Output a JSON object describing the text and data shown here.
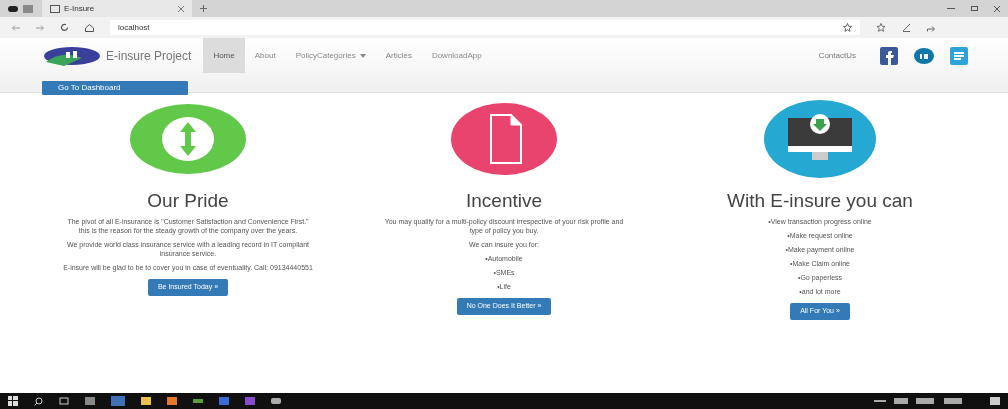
{
  "browser": {
    "tab_title": "E-Insure",
    "url": "localhost"
  },
  "navbar": {
    "brand": "E-insure Project",
    "items": [
      {
        "label": "Home",
        "kind": "link",
        "selected": true
      },
      {
        "label": "About",
        "kind": "link",
        "selected": false
      },
      {
        "label": "PolicyCategories",
        "kind": "dropdown",
        "selected": false
      },
      {
        "label": "Articles",
        "kind": "link",
        "selected": false
      },
      {
        "label": "DownloadApp",
        "kind": "link",
        "selected": false
      }
    ],
    "contact": "ContactUs",
    "dashboard_button": "Go To Dashboard"
  },
  "features": [
    {
      "kind": "arrows",
      "title": "Our Pride",
      "paragraphs": [
        "The pivot of all E-insurance is \"Customer Satisfaction and Convenience First.\" this is the reason for the steady growth of the company over the years.",
        "We provide world class insurance service with a leading record in IT compliant insurance service.",
        "E-insure will be glad to be to cover you in case of eventuality. Call: 09134440551"
      ],
      "button": "Be Insured Today »"
    },
    {
      "kind": "document",
      "title": "Incentive",
      "paragraphs": [
        "You may qualify for a multi-policy discount irrespective of your risk profile and type of policy you buy.",
        "We can insure you for:",
        "•Automobile",
        "•SMEs",
        "•Life"
      ],
      "button": "No One Does It Better »"
    },
    {
      "kind": "monitor",
      "title": "With E-insure you can",
      "paragraphs": [
        "•View transaction progress online",
        "•Make request online",
        "•Make payment online",
        "•Make Claim online",
        "•Go paperless",
        "•and lot more"
      ],
      "button": "All For You »"
    }
  ]
}
